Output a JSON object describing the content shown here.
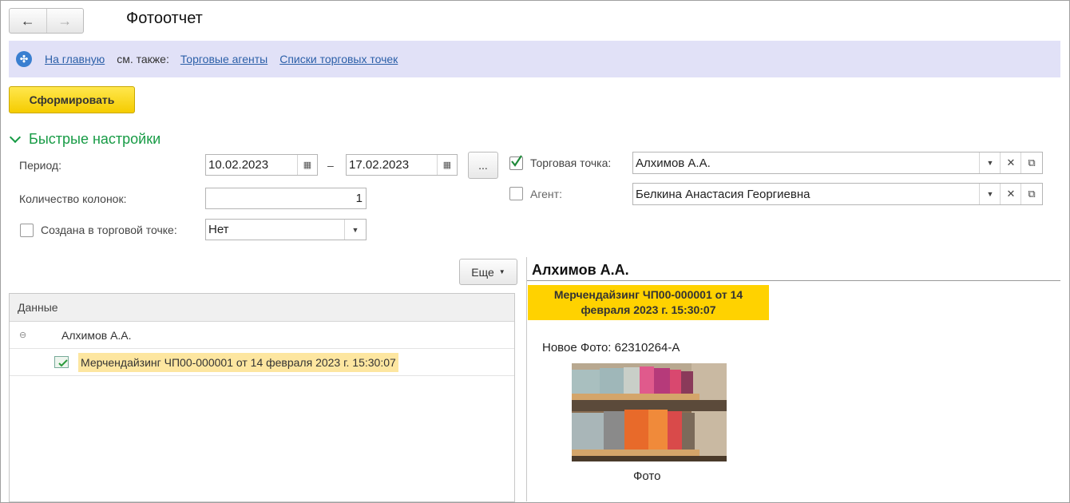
{
  "window": {
    "title": "Фотоотчет"
  },
  "nav": {
    "back_icon": "←",
    "forward_icon": "→"
  },
  "links_bar": {
    "home": "На главную",
    "see_also": "см. также:",
    "links": [
      "Торговые агенты",
      "Списки торговых точек"
    ]
  },
  "toolbar": {
    "generate": "Сформировать",
    "more": "Еще"
  },
  "quick_settings": {
    "title": "Быстрые настройки",
    "period_label": "Период:",
    "date_from": "10.02.2023",
    "dash": "–",
    "date_to": "17.02.2023",
    "ellipsis": "...",
    "columns_label": "Количество колонок:",
    "columns_value": "1",
    "created_label": "Создана в торговой точке:",
    "created_value": "Нет",
    "outlet_label": "Торговая точка:",
    "outlet_checked": true,
    "outlet_value": "Алхимов А.А.",
    "agent_label": "Агент:",
    "agent_checked": false,
    "agent_value": "Белкина Анастасия Георгиевна"
  },
  "tree": {
    "header": "Данные",
    "group": "Алхимов А.А.",
    "item": "Мерчендайзинг ЧП00-000001 от 14 февраля 2023 г. 15:30:07"
  },
  "report": {
    "name": "Алхимов А.А.",
    "doc_line1": "Мерчендайзинг ЧП00-000001 от 14",
    "doc_line2": "февраля 2023 г. 15:30:07",
    "new_photo": "Новое Фото: 62310264-A",
    "caption": "Фото"
  },
  "colors": {
    "accent_yellow": "#ffd200",
    "link_bar": "#e1e1f7",
    "section_green": "#179b45",
    "link": "#2b5fa8"
  }
}
